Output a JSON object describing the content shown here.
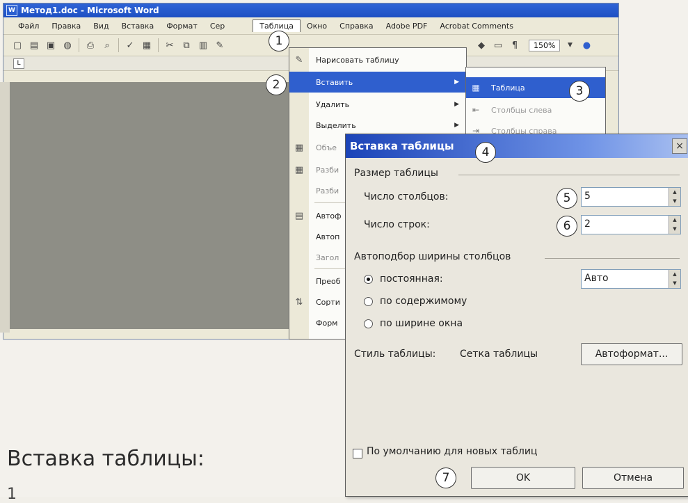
{
  "window": {
    "title": "Метод1.doc - Microsoft Word",
    "menu": [
      "Файл",
      "Правка",
      "Вид",
      "Вставка",
      "Формат",
      "Сер",
      "Таблица",
      "Окно",
      "Справка",
      "Adobe PDF",
      "Acrobat Comments"
    ],
    "zoom": "150%"
  },
  "table_menu": {
    "items": [
      {
        "label": "Нарисовать таблицу",
        "icon": "pencil-icon"
      },
      {
        "label": "Вставить",
        "arrow": "▶",
        "highlighted": true
      },
      {
        "label": "Удалить",
        "arrow": "▶"
      },
      {
        "label": "Выделить",
        "arrow": "▶"
      },
      {
        "label": "Объе",
        "dim": true
      },
      {
        "label": "Разби",
        "dim": true
      },
      {
        "label": "Разби",
        "dim": true
      },
      {
        "label": "Автоф"
      },
      {
        "label": "Автоп"
      },
      {
        "label": "Загол",
        "dim": true
      },
      {
        "label": "Преоб"
      },
      {
        "label": "Сорти"
      },
      {
        "label": "Форм"
      }
    ]
  },
  "insert_submenu": {
    "items": [
      {
        "label": "Таблица",
        "highlighted": true
      },
      {
        "label": "Столбцы слева"
      },
      {
        "label": "Столбцы справа"
      }
    ]
  },
  "dialog": {
    "title": "Вставка таблицы",
    "close": "×",
    "size_group": "Размер таблицы",
    "columns_label": "Число столбцов:",
    "columns_value": "5",
    "rows_label": "Число строк:",
    "rows_value": "2",
    "autofit_group": "Автоподбор ширины столбцов",
    "radio_fixed": "постоянная:",
    "radio_content": "по содержимому",
    "radio_window": "по ширине окна",
    "fixed_value": "Авто",
    "style_label": "Стиль таблицы:",
    "style_value": "Сетка таблицы",
    "autoformat_button": "Автоформат...",
    "default_checkbox": "По умолчанию для новых таблиц",
    "ok_button": "OK",
    "cancel_button": "Отмена"
  },
  "badges": [
    "1",
    "2",
    "3",
    "4",
    "5",
    "6",
    "7"
  ],
  "caption": "Вставка таблицы:",
  "caption_next": "1"
}
